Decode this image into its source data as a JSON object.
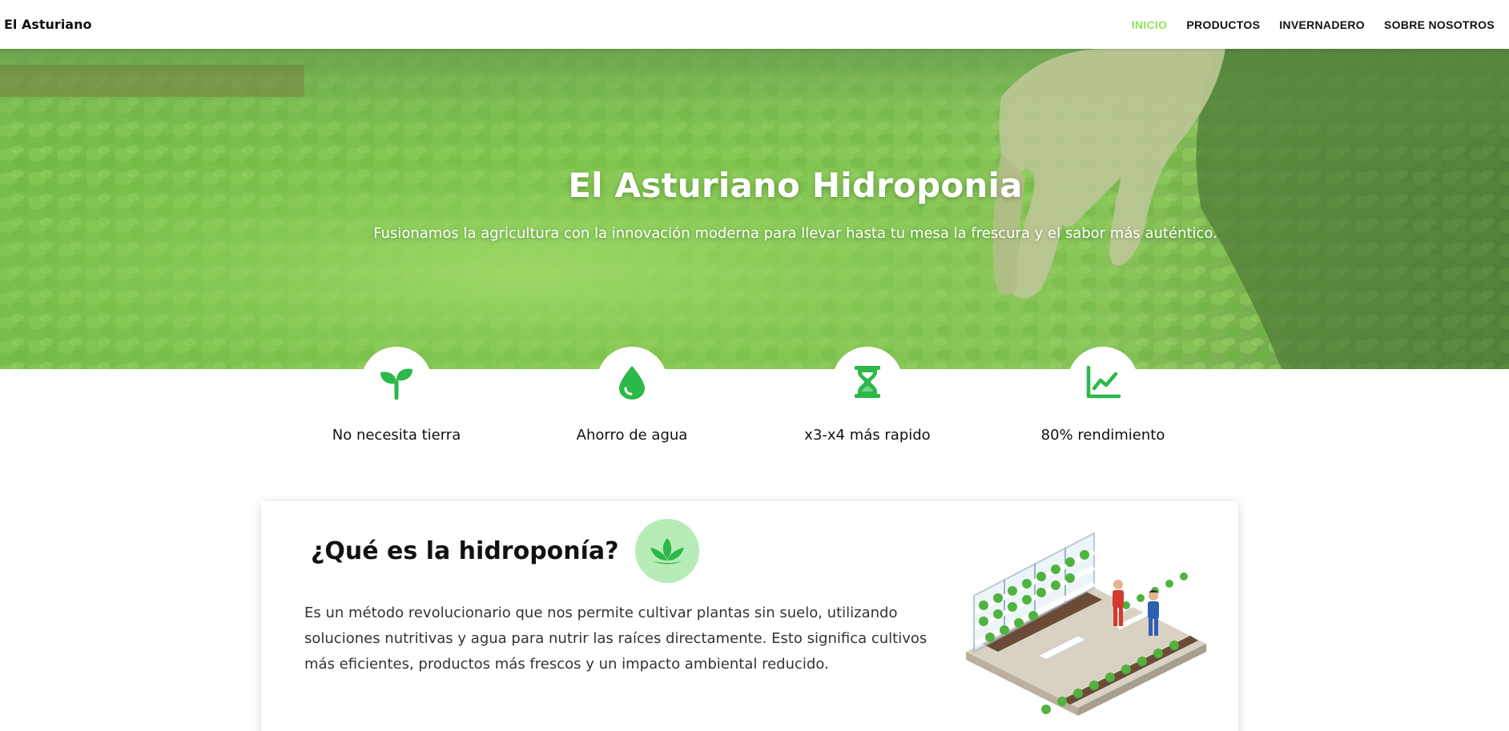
{
  "navbar": {
    "brand": "El Asturiano",
    "links": [
      {
        "label": "INICIO",
        "active": true
      },
      {
        "label": "PRODUCTOS",
        "active": false
      },
      {
        "label": "INVERNADERO",
        "active": false
      },
      {
        "label": "SOBRE NOSOTROS",
        "active": false
      }
    ]
  },
  "hero": {
    "title": "El Asturiano Hidroponia",
    "subtitle": "Fusionamos la agricultura con la innovación moderna para llevar hasta tu mesa la frescura y el sabor más auténtico."
  },
  "features": [
    {
      "label": "No necesita tierra",
      "icon": "sprout-icon"
    },
    {
      "label": "Ahorro de agua",
      "icon": "water-drop-icon"
    },
    {
      "label": "x3-x4 más rapido",
      "icon": "hourglass-icon"
    },
    {
      "label": "80% rendimiento",
      "icon": "chart-line-icon"
    }
  ],
  "about": {
    "title": "¿Qué es la hidroponía?",
    "icon": "leaf-icon",
    "text": "Es un método revolucionario que nos permite cultivar plantas sin suelo, utilizando soluciones nutritivas y agua para nutrir las raíces directamente. Esto significa cultivos más eficientes, productos más frescos y un impacto ambiental reducido."
  },
  "colors": {
    "accent": "#8fe35a",
    "icon_green": "#2db84a",
    "icon_bg": "#b7ecb7"
  }
}
